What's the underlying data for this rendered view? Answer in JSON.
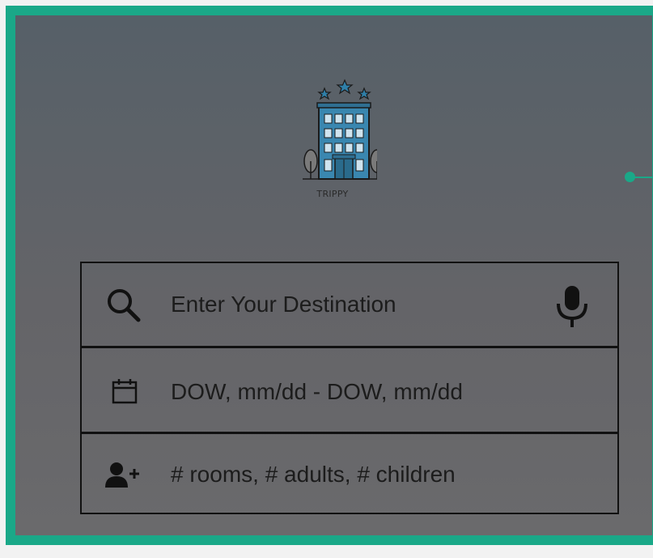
{
  "brand": {
    "name": "TRIPPY"
  },
  "search": {
    "destination_placeholder": "Enter Your Destination",
    "dates_placeholder": "DOW, mm/dd - DOW, mm/dd",
    "guests_placeholder": "# rooms, # adults, # children"
  },
  "icons": {
    "logo": "hotel-building-logo",
    "search": "search-icon",
    "mic": "microphone-icon",
    "calendar": "calendar-icon",
    "add_user": "add-user-icon"
  },
  "colors": {
    "accent": "#1aa888",
    "background_top": "#566068",
    "background_bottom": "#6a6a6c",
    "text": "#1c1c1c"
  }
}
